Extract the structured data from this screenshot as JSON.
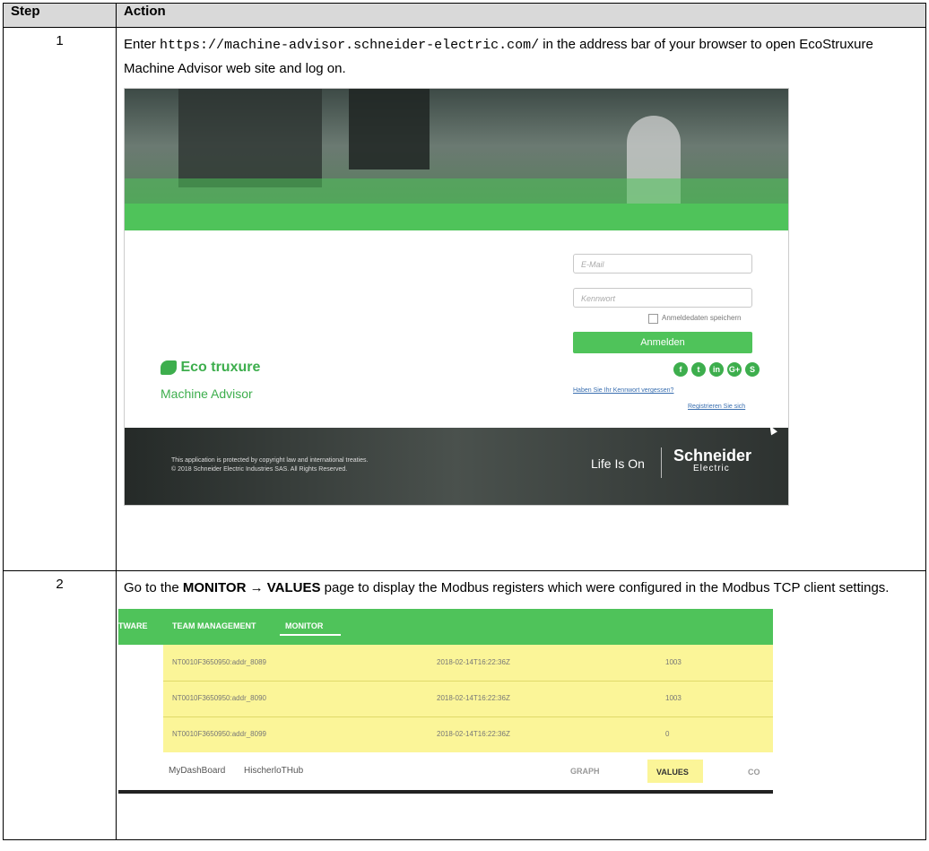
{
  "table": {
    "headers": {
      "step": "Step",
      "action": "Action"
    },
    "step1": {
      "number": "1",
      "text_before": "Enter ",
      "url": "https://machine-advisor.schneider-electric.com/",
      "text_after": " in the address bar of your browser to open EcoStruxure Machine Advisor web site and log on."
    },
    "step2": {
      "number": "2",
      "text_before": "Go to the ",
      "nav_path": "MONITOR → VALUES",
      "text_after": " page to display the Modbus registers which were configured in the Modbus TCP client settings."
    }
  },
  "login_screen": {
    "email_placeholder": "E-Mail",
    "password_placeholder": "Kennwort",
    "remember_label": "Anmeldedaten speichern",
    "login_button": "Anmelden",
    "social_icons": [
      "f",
      "t",
      "in",
      "G+",
      "S"
    ],
    "forgot_link": "Haben Sie Ihr Kennwort vergessen?",
    "register_link": "Registrieren Sie sich",
    "logo_text": "Eco truxure",
    "app_name": "Machine Advisor",
    "copyright_line1": "This application is protected by copyright law and international treaties.",
    "copyright_line2": "© 2018 Schneider Electric Industries SAS. All Rights Reserved.",
    "tagline": "Life Is On",
    "brand_name": "Schneider",
    "brand_sub": "Electric",
    "accent_color": "#4fc35a"
  },
  "monitor_screen": {
    "nav": {
      "item1": "TWARE",
      "item2": "TEAM MANAGEMENT",
      "item3": "MONITOR"
    },
    "rows": [
      {
        "name": "NT0010F3650950:addr_8089",
        "timestamp": "2018-02-14T16:22:36Z",
        "value": "1003"
      },
      {
        "name": "NT0010F3650950:addr_8090",
        "timestamp": "2018-02-14T16:22:36Z",
        "value": "1003"
      },
      {
        "name": "NT0010F3650950:addr_8099",
        "timestamp": "2018-02-14T16:22:36Z",
        "value": "0"
      }
    ],
    "tabs": {
      "dashboard": "MyDashBoard",
      "hub": "HischerloTHub",
      "graph": "GRAPH",
      "values": "VALUES",
      "more": "CO"
    },
    "highlight_color": "#fbf598"
  }
}
